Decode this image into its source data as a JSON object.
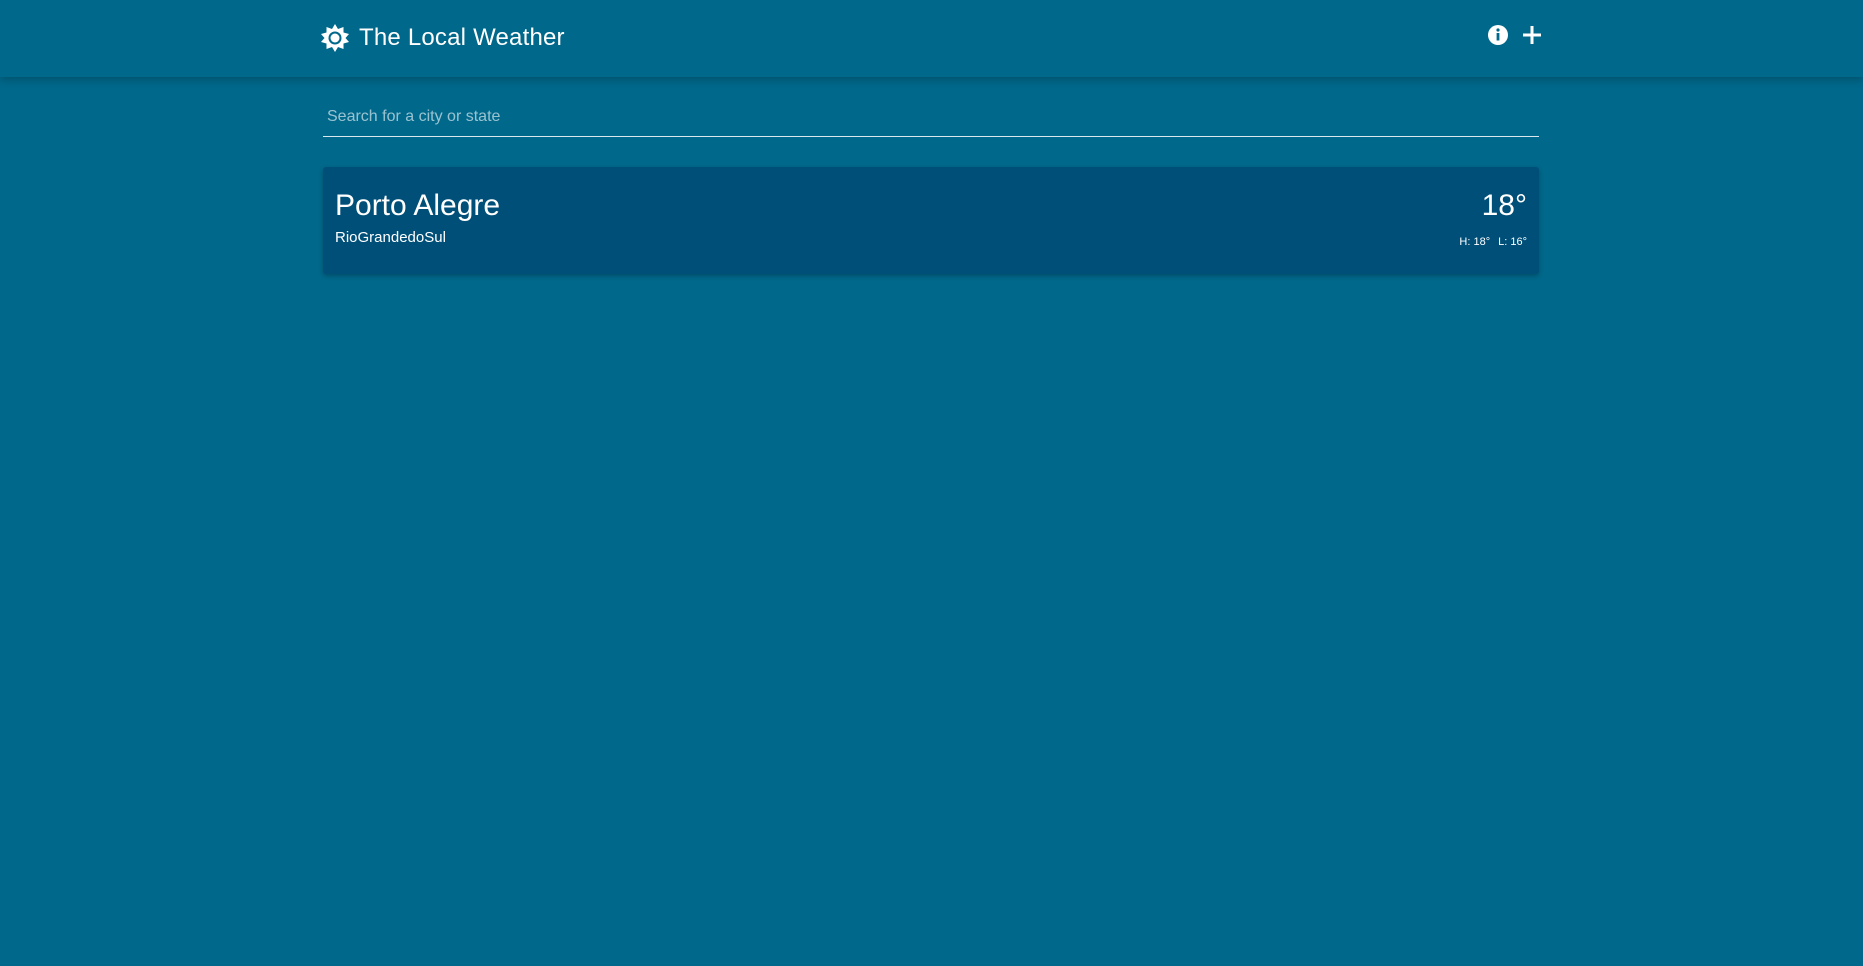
{
  "app": {
    "title": "The Local Weather",
    "logo_icon": "sun-icon"
  },
  "header_actions": [
    {
      "name": "info",
      "icon": "info-icon"
    },
    {
      "name": "add",
      "icon": "plus-icon"
    }
  ],
  "search": {
    "placeholder": "Search for a city or state",
    "value": ""
  },
  "locations": [
    {
      "city": "Porto Alegre",
      "region": "RioGrandedoSul",
      "temperature": "18°",
      "high": "H: 18°",
      "low": "L: 16°"
    }
  ],
  "colors": {
    "background": "#00688b",
    "card": "#004f78",
    "text": "#ffffff"
  }
}
